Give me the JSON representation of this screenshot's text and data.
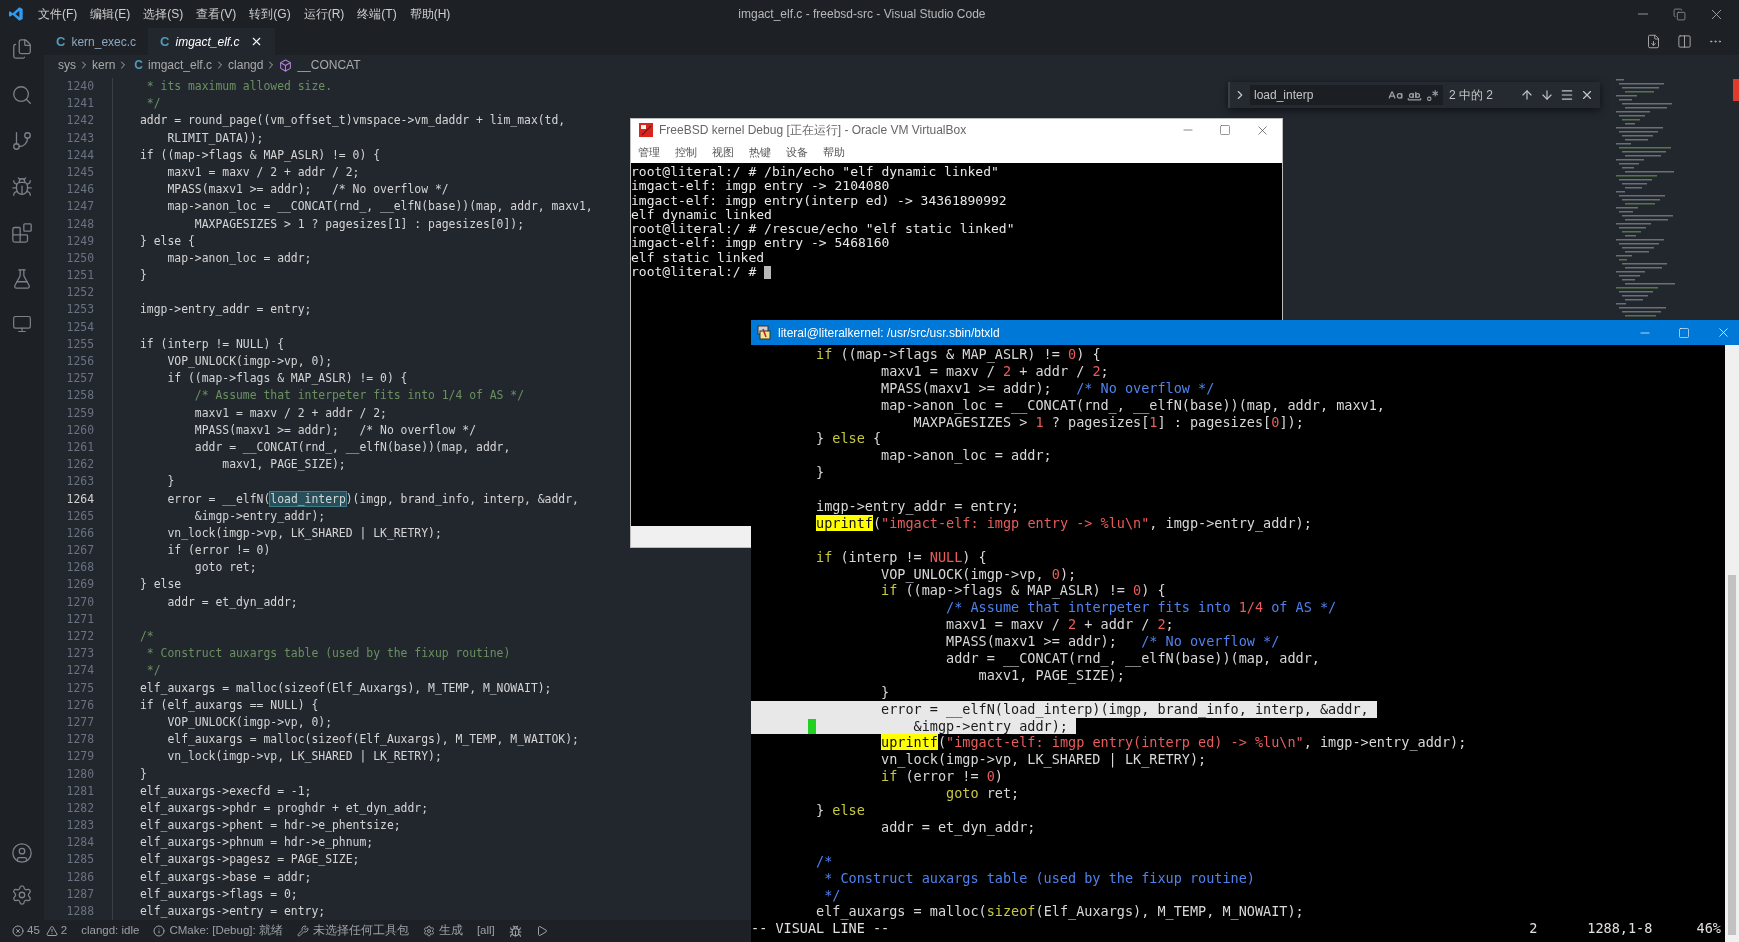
{
  "window": {
    "title": "imgact_elf.c - freebsd-src - Visual Studio Code"
  },
  "menu": [
    "文件(F)",
    "编辑(E)",
    "选择(S)",
    "查看(V)",
    "转到(G)",
    "运行(R)",
    "终端(T)",
    "帮助(H)"
  ],
  "tabs": [
    {
      "icon": "C",
      "label": "kern_exec.c",
      "selected": false
    },
    {
      "icon": "C",
      "label": "imgact_elf.c",
      "selected": true
    }
  ],
  "breadcrumbs": [
    {
      "kind": "folder",
      "label": "sys"
    },
    {
      "kind": "folder",
      "label": "kern"
    },
    {
      "kind": "file",
      "icon": "C",
      "label": "imgact_elf.c"
    },
    {
      "kind": "folder",
      "label": "clangd"
    },
    {
      "kind": "symbol",
      "label": "__CONCAT"
    }
  ],
  "find": {
    "value": "load_interp",
    "result": "2 中的 2"
  },
  "editor": {
    "lines": [
      {
        "number": "1240",
        "kind": "comment",
        "text": " * its maximum allowed size.",
        "current": false
      },
      {
        "number": "1241",
        "kind": "comment",
        "text": " */",
        "current": false
      },
      {
        "number": "1242",
        "kind": "code",
        "text": "addr = round_page((vm_offset_t)vmspace->vm_daddr + lim_max(td,",
        "current": false
      },
      {
        "number": "1243",
        "kind": "code",
        "text": "    RLIMIT_DATA));",
        "current": false
      },
      {
        "number": "1244",
        "kind": "code",
        "text": "if ((map->flags & MAP_ASLR) != 0) {",
        "current": false
      },
      {
        "number": "1245",
        "kind": "code",
        "text": "    maxv1 = maxv / 2 + addr / 2;",
        "current": false
      },
      {
        "number": "1246",
        "kind": "code",
        "text": "    MPASS(maxv1 >= addr);   /* No overflow */",
        "current": false
      },
      {
        "number": "1247",
        "kind": "code",
        "text": "    map->anon_loc = __CONCAT(rnd_, __elfN(base))(map, addr, maxv1,",
        "current": false
      },
      {
        "number": "1248",
        "kind": "code",
        "text": "        MAXPAGESIZES > 1 ? pagesizes[1] : pagesizes[0]);",
        "current": false
      },
      {
        "number": "1249",
        "kind": "code",
        "text": "} else {",
        "current": false
      },
      {
        "number": "1250",
        "kind": "code",
        "text": "    map->anon_loc = addr;",
        "current": false
      },
      {
        "number": "1251",
        "kind": "code",
        "text": "}",
        "current": false
      },
      {
        "number": "1252",
        "current": false
      },
      {
        "number": "1253",
        "kind": "code",
        "text": "imgp->entry_addr = entry;",
        "current": false
      },
      {
        "number": "1254",
        "current": false
      },
      {
        "number": "1255",
        "kind": "code",
        "text": "if (interp != NULL) {",
        "current": false
      },
      {
        "number": "1256",
        "kind": "code",
        "text": "    VOP_UNLOCK(imgp->vp, 0);",
        "current": false
      },
      {
        "number": "1257",
        "kind": "code",
        "text": "    if ((map->flags & MAP_ASLR) != 0) {",
        "current": false
      },
      {
        "number": "1258",
        "kind": "comment",
        "text": "        /* Assume that interpeter fits into 1/4 of AS */",
        "current": false
      },
      {
        "number": "1259",
        "kind": "code",
        "text": "        maxv1 = maxv / 2 + addr / 2;",
        "current": false
      },
      {
        "number": "1260",
        "kind": "code",
        "text": "        MPASS(maxv1 >= addr);   /* No overflow */",
        "current": false
      },
      {
        "number": "1261",
        "kind": "code",
        "text": "        addr = __CONCAT(rnd_, __elfN(base))(map, addr,",
        "current": false
      },
      {
        "number": "1262",
        "kind": "code",
        "text": "            maxv1, PAGE_SIZE);",
        "current": false
      },
      {
        "number": "1263",
        "kind": "code",
        "text": "    }",
        "current": false
      },
      {
        "number": "1264",
        "parts": [
          {
            "text": "    error = __elfN(",
            "match": false
          },
          {
            "text": "load_interp",
            "match": true
          },
          {
            "text": ")(imgp, brand_info, interp, &addr,",
            "match": false
          }
        ],
        "current": true
      },
      {
        "number": "1265",
        "kind": "code",
        "text": "        &imgp->entry_addr);",
        "current": false
      },
      {
        "number": "1266",
        "kind": "code",
        "text": "    vn_lock(imgp->vp, LK_SHARED | LK_RETRY);",
        "current": false
      },
      {
        "number": "1267",
        "kind": "code",
        "text": "    if (error != 0)",
        "current": false
      },
      {
        "number": "1268",
        "kind": "code",
        "text": "        goto ret;",
        "current": false
      },
      {
        "number": "1269",
        "kind": "code",
        "text": "} else",
        "current": false
      },
      {
        "number": "1270",
        "kind": "code",
        "text": "    addr = et_dyn_addr;",
        "current": false
      },
      {
        "number": "1271",
        "current": false
      },
      {
        "number": "1272",
        "kind": "comment",
        "text": "/*",
        "current": false
      },
      {
        "number": "1273",
        "kind": "comment",
        "text": " * Construct auxargs table (used by the fixup routine)",
        "current": false
      },
      {
        "number": "1274",
        "kind": "comment",
        "text": " */",
        "current": false
      },
      {
        "number": "1275",
        "kind": "code",
        "text": "elf_auxargs = malloc(sizeof(Elf_Auxargs), M_TEMP, M_NOWAIT);",
        "current": false
      },
      {
        "number": "1276",
        "kind": "code",
        "text": "if (elf_auxargs == NULL) {",
        "current": false
      },
      {
        "number": "1277",
        "kind": "code",
        "text": "    VOP_UNLOCK(imgp->vp, 0);",
        "current": false
      },
      {
        "number": "1278",
        "kind": "code",
        "text": "    elf_auxargs = malloc(sizeof(Elf_Auxargs), M_TEMP, M_WAITOK);",
        "current": false
      },
      {
        "number": "1279",
        "kind": "code",
        "text": "    vn_lock(imgp->vp, LK_SHARED | LK_RETRY);",
        "current": false
      },
      {
        "number": "1280",
        "kind": "code",
        "text": "}",
        "current": false
      },
      {
        "number": "1281",
        "kind": "code",
        "text": "elf_auxargs->execfd = -1;",
        "current": false
      },
      {
        "number": "1282",
        "kind": "code",
        "text": "elf_auxargs->phdr = proghdr + et_dyn_addr;",
        "current": false
      },
      {
        "number": "1283",
        "kind": "code",
        "text": "elf_auxargs->phent = hdr->e_phentsize;",
        "current": false
      },
      {
        "number": "1284",
        "kind": "code",
        "text": "elf_auxargs->phnum = hdr->e_phnum;",
        "current": false
      },
      {
        "number": "1285",
        "kind": "code",
        "text": "elf_auxargs->pagesz = PAGE_SIZE;",
        "current": false
      },
      {
        "number": "1286",
        "kind": "code",
        "text": "elf_auxargs->base = addr;",
        "current": false
      },
      {
        "number": "1287",
        "kind": "code",
        "text": "elf_auxargs->flags = 0;",
        "current": false
      },
      {
        "number": "1288",
        "kind": "code",
        "text": "elf_auxargs->entry = entry;",
        "current": false
      }
    ]
  },
  "status_bar": {
    "errors": "45",
    "warnings": "2",
    "items": [
      {
        "kind": "plain",
        "text": "clangd: idle"
      },
      {
        "kind": "info",
        "text": "CMake: [Debug]: 就绪"
      },
      {
        "kind": "tools",
        "text": "未选择任何工具包"
      },
      {
        "kind": "gear",
        "text": "生成"
      },
      {
        "kind": "plain",
        "text": "[all]"
      }
    ]
  },
  "vm_window": {
    "title": "FreeBSD kernel Debug [正在运行] - Oracle VM VirtualBox",
    "menu": [
      "管理",
      "控制",
      "视图",
      "热键",
      "设备",
      "帮助"
    ],
    "console": [
      "root@literal:/ # /bin/echo \"elf dynamic linked\"",
      "imgact-elf: imgp entry -> 2104080",
      "imgact-elf: imgp entry(interp ed) -> 34361890992",
      "elf dynamic linked",
      "root@literal:/ # /rescue/echo \"elf static linked\"",
      "imgact-elf: imgp entry -> 5468160",
      "elf static linked",
      "root@literal:/ #"
    ]
  },
  "terminal": {
    "title": "literal@literalkernel: /usr/src/usr.sbin/btxld",
    "lines": [
      {
        "selected": false,
        "parts": [
          {
            "text": "        if",
            "kind": "keyword"
          },
          {
            "text": " ((map->flags & MAP_ASLR) != ",
            "kind": "plain"
          },
          {
            "text": "0",
            "kind": "number"
          },
          {
            "text": ") {",
            "kind": "plain"
          }
        ]
      },
      {
        "selected": false,
        "parts": [
          {
            "text": "                maxv1 = maxv / ",
            "kind": "plain"
          },
          {
            "text": "2",
            "kind": "number"
          },
          {
            "text": " + addr / ",
            "kind": "plain"
          },
          {
            "text": "2",
            "kind": "number"
          },
          {
            "text": ";",
            "kind": "plain"
          }
        ]
      },
      {
        "selected": false,
        "parts": [
          {
            "text": "                MPASS(maxv1 >= addr);   ",
            "kind": "plain"
          },
          {
            "text": "/* No overflow */",
            "kind": "comment"
          }
        ]
      },
      {
        "selected": false,
        "parts": [
          {
            "text": "                map->anon_loc = __CONCAT(rnd_, __elfN(base))(map, addr, maxv1,",
            "kind": "plain"
          }
        ]
      },
      {
        "selected": false,
        "parts": [
          {
            "text": "                    MAXPAGESIZES > ",
            "kind": "plain"
          },
          {
            "text": "1",
            "kind": "number"
          },
          {
            "text": " ? pagesizes[",
            "kind": "plain"
          },
          {
            "text": "1",
            "kind": "number"
          },
          {
            "text": "] : pagesizes[",
            "kind": "plain"
          },
          {
            "text": "0",
            "kind": "number"
          },
          {
            "text": "]);",
            "kind": "plain"
          }
        ]
      },
      {
        "selected": false,
        "parts": [
          {
            "text": "        } ",
            "kind": "plain"
          },
          {
            "text": "else",
            "kind": "keyword"
          },
          {
            "text": " {",
            "kind": "plain"
          }
        ]
      },
      {
        "selected": false,
        "parts": [
          {
            "text": "                map->anon_loc = addr;",
            "kind": "plain"
          }
        ]
      },
      {
        "selected": false,
        "parts": [
          {
            "text": "        }",
            "kind": "plain"
          }
        ]
      },
      {
        "selected": false
      },
      {
        "selected": false,
        "parts": [
          {
            "text": "        imgp->entry_addr = entry;",
            "kind": "plain"
          }
        ]
      },
      {
        "selected": false,
        "parts": [
          {
            "text": "        uprintf",
            "kind": "search"
          },
          {
            "text": "(",
            "kind": "plain"
          },
          {
            "text": "\"imgact-elf: imgp entry -> %lu\\n\"",
            "kind": "string"
          },
          {
            "text": ", imgp->entry_addr);",
            "kind": "plain"
          }
        ]
      },
      {
        "selected": false
      },
      {
        "selected": false,
        "parts": [
          {
            "text": "        if",
            "kind": "keyword"
          },
          {
            "text": " (interp != ",
            "kind": "plain"
          },
          {
            "text": "NULL",
            "kind": "number"
          },
          {
            "text": ") {",
            "kind": "plain"
          }
        ]
      },
      {
        "selected": false,
        "parts": [
          {
            "text": "                VOP_UNLOCK(imgp->vp, ",
            "kind": "plain"
          },
          {
            "text": "0",
            "kind": "number"
          },
          {
            "text": ");",
            "kind": "plain"
          }
        ]
      },
      {
        "selected": false,
        "parts": [
          {
            "text": "                if",
            "kind": "keyword"
          },
          {
            "text": " ((map->flags & MAP_ASLR) != ",
            "kind": "plain"
          },
          {
            "text": "0",
            "kind": "number"
          },
          {
            "text": ") {",
            "kind": "plain"
          }
        ]
      },
      {
        "selected": false,
        "parts": [
          {
            "text": "                        /* Assume that interpeter fits into ",
            "kind": "comment"
          },
          {
            "text": "1/4",
            "kind": "number"
          },
          {
            "text": " of AS */",
            "kind": "comment"
          }
        ]
      },
      {
        "selected": false,
        "parts": [
          {
            "text": "                        maxv1 = maxv / ",
            "kind": "plain"
          },
          {
            "text": "2",
            "kind": "number"
          },
          {
            "text": " + addr / ",
            "kind": "plain"
          },
          {
            "text": "2",
            "kind": "number"
          },
          {
            "text": ";",
            "kind": "plain"
          }
        ]
      },
      {
        "selected": false,
        "parts": [
          {
            "text": "                        MPASS(maxv1 >= addr);   ",
            "kind": "plain"
          },
          {
            "text": "/* No overflow */",
            "kind": "comment"
          }
        ]
      },
      {
        "selected": false,
        "parts": [
          {
            "text": "                        addr = __CONCAT(rnd_, __elfN(base))(map, addr,",
            "kind": "plain"
          }
        ]
      },
      {
        "selected": false,
        "parts": [
          {
            "text": "                            maxv1, PAGE_SIZE);",
            "kind": "plain"
          }
        ]
      },
      {
        "selected": false,
        "parts": [
          {
            "text": "                }",
            "kind": "plain"
          }
        ]
      },
      {
        "selected": true,
        "parts": [
          {
            "text": "                error = __elfN(load_interp)(imgp, brand_info, interp, &addr,",
            "kind": "plain"
          }
        ]
      },
      {
        "selected": true,
        "cursor": true,
        "parts": [
          {
            "text": "                    &imgp->entry_addr);",
            "kind": "plain"
          }
        ]
      },
      {
        "selected": false,
        "parts": [
          {
            "text": "                uprintf",
            "kind": "search"
          },
          {
            "text": "(",
            "kind": "plain"
          },
          {
            "text": "\"imgact-elf: imgp entry(interp ed) -> %lu\\n\"",
            "kind": "string"
          },
          {
            "text": ", imgp->entry_addr);",
            "kind": "plain"
          }
        ]
      },
      {
        "selected": false,
        "parts": [
          {
            "text": "                vn_lock(imgp->vp, LK_SHARED | LK_RETRY);",
            "kind": "plain"
          }
        ]
      },
      {
        "selected": false,
        "parts": [
          {
            "text": "                if",
            "kind": "keyword"
          },
          {
            "text": " (error != ",
            "kind": "plain"
          },
          {
            "text": "0",
            "kind": "number"
          },
          {
            "text": ")",
            "kind": "plain"
          }
        ]
      },
      {
        "selected": false,
        "parts": [
          {
            "text": "                        goto",
            "kind": "keyword"
          },
          {
            "text": " ret;",
            "kind": "plain"
          }
        ]
      },
      {
        "selected": false,
        "parts": [
          {
            "text": "        } ",
            "kind": "plain"
          },
          {
            "text": "else",
            "kind": "keyword"
          }
        ]
      },
      {
        "selected": false,
        "parts": [
          {
            "text": "                addr = et_dyn_addr;",
            "kind": "plain"
          }
        ]
      },
      {
        "selected": false
      },
      {
        "selected": false,
        "parts": [
          {
            "text": "        /*",
            "kind": "comment"
          }
        ]
      },
      {
        "selected": false,
        "parts": [
          {
            "text": "         * Construct auxargs table (used by the fixup routine)",
            "kind": "comment"
          }
        ]
      },
      {
        "selected": false,
        "parts": [
          {
            "text": "         */",
            "kind": "comment"
          }
        ]
      },
      {
        "selected": false,
        "parts": [
          {
            "text": "        elf_auxargs = malloc(",
            "kind": "plain"
          },
          {
            "text": "sizeof",
            "kind": "keyword"
          },
          {
            "text": "(Elf_Auxargs), M_TEMP, M_NOWAIT);",
            "kind": "plain"
          }
        ]
      }
    ],
    "status": {
      "mode": "-- VISUAL LINE --",
      "count": "2",
      "position": "1288,1-8",
      "scroll": "46%"
    }
  }
}
